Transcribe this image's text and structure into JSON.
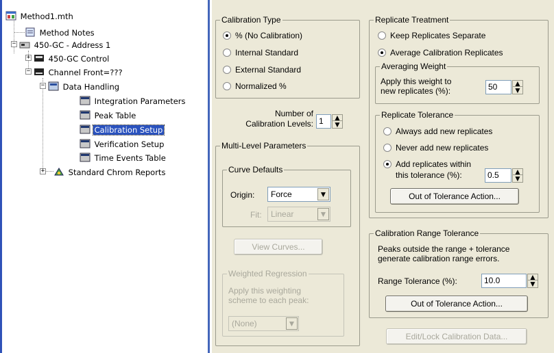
{
  "tree": {
    "root": "Method1.mth",
    "method_notes": "Method Notes",
    "address": "450-GC - Address 1",
    "gc_control": "450-GC Control",
    "channel": "Channel Front=???",
    "data_handling": "Data Handling",
    "integration": "Integration Parameters",
    "peak_table": "Peak Table",
    "calibration_setup": "Calibration Setup",
    "verification": "Verification Setup",
    "time_events": "Time Events Table",
    "reports": "Standard Chrom Reports"
  },
  "calibration_type": {
    "title": "Calibration Type",
    "options": [
      "% (No Calibration)",
      "Internal Standard",
      "External Standard",
      "Normalized %"
    ],
    "selected": 0
  },
  "levels": {
    "label_line1": "Number of",
    "label_line2": "Calibration Levels:",
    "value": "1"
  },
  "multi_level": {
    "title": "Multi-Level Parameters",
    "curve_defaults": {
      "title": "Curve Defaults",
      "origin_label": "Origin:",
      "origin_value": "Force",
      "fit_label": "Fit:",
      "fit_value": "Linear"
    },
    "view_curves": "View Curves...",
    "weighted": {
      "title": "Weighted Regression",
      "line1": "Apply this weighting",
      "line2": "scheme to each peak:",
      "value": "(None)"
    }
  },
  "replicate": {
    "title": "Replicate Treatment",
    "keep_separate": "Keep Replicates Separate",
    "average": "Average Calibration Replicates",
    "averaging_weight": {
      "title": "Averaging Weight",
      "line1": "Apply this weight to",
      "line2": "new replicates (%):",
      "value": "50"
    },
    "tolerance": {
      "title": "Replicate Tolerance",
      "always": "Always add new replicates",
      "never": "Never add new replicates",
      "within1": "Add replicates within",
      "within2": "this tolerance (%):",
      "value": "0.5",
      "action": "Out of Tolerance Action..."
    }
  },
  "range": {
    "title": "Calibration Range Tolerance",
    "desc1": "Peaks outside the range + tolerance",
    "desc2": "generate calibration range errors.",
    "label": "Range Tolerance (%):",
    "value": "10.0",
    "action": "Out of Tolerance Action..."
  },
  "edit_lock": "Edit/Lock Calibration Data..."
}
